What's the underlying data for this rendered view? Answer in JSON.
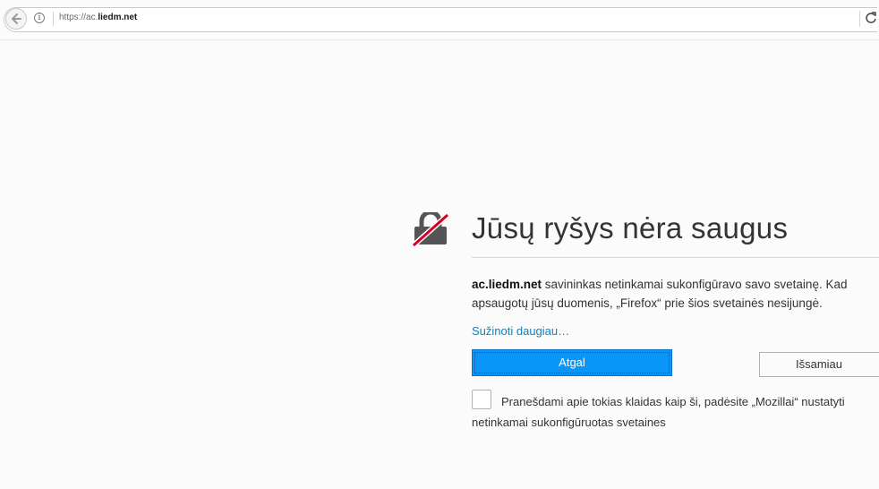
{
  "browser": {
    "url_prefix": "https://ac.",
    "url_domain": "liedm.net",
    "back_icon": "back-arrow-icon",
    "info_icon_glyph": "i",
    "reload_icon_glyph": "C"
  },
  "error": {
    "title": "Jūsų ryšys nėra saugus",
    "host": "ac.liedm.net",
    "description": " savininkas netinkamai sukonfigūravo savo svetainę. Kad apsaugotų jūsų duomenis, „Firefox“ prie šios svetainės nesijungė.",
    "learn_more": "Sužinoti daugiau…",
    "back_button": "Atgal",
    "advanced_button": "Išsamiau",
    "report_text": "Pranešdami apie tokias klaidas kaip ši, padėsite „Mozillai“ nustatyti netinkamai sukonfigūruotas svetaines",
    "accent_color": "#0996f8",
    "icon": "broken-lock-icon"
  }
}
